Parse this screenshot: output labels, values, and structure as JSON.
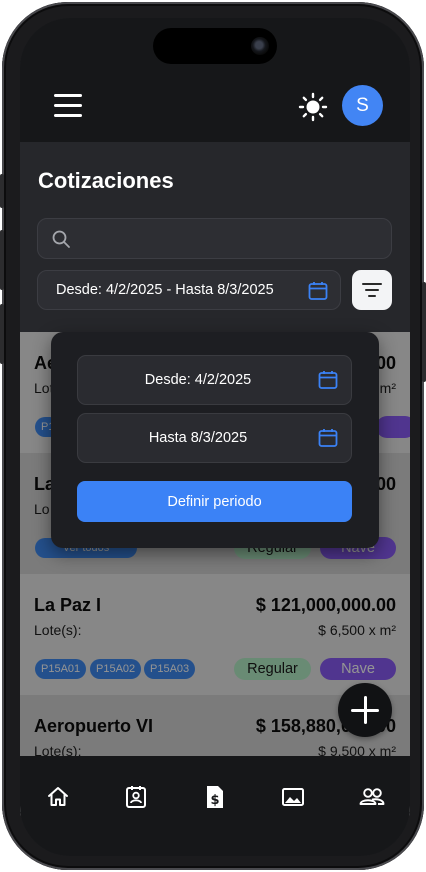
{
  "header": {
    "avatar_initial": "S"
  },
  "page": {
    "title": "Cotizaciones"
  },
  "search": {
    "placeholder": ""
  },
  "filter": {
    "range_text": "Desde: 4/2/2025 - Hasta 8/3/2025"
  },
  "popover": {
    "from_text": "Desde: 4/2/2025",
    "to_text": "Hasta 8/3/2025",
    "define_button": "Definir periodo"
  },
  "quotes": [
    {
      "name": "Ae",
      "price": "00",
      "lots_label": "Lot",
      "rate": "m²",
      "chips": [
        "P1"
      ],
      "status": "",
      "type": ""
    },
    {
      "name": "La",
      "price": "00",
      "lots_label": "Lo",
      "rate": "",
      "see_all": "Ver todos",
      "status": "Regular",
      "type": "Nave"
    },
    {
      "name": "La Paz I",
      "price": "$ 121,000,000.00",
      "lots_label": "Lote(s):",
      "rate": "$ 6,500 x m²",
      "chips": [
        "P15A01",
        "P15A02",
        "P15A03"
      ],
      "status": "Regular",
      "type": "Nave"
    },
    {
      "name": "Aeropuerto VI",
      "price": "$ 158,880,000.00",
      "lots_label": "Lote(s):",
      "rate": "$ 9,500 x m²"
    }
  ],
  "colors": {
    "accent_blue": "#3b82f6",
    "status_regular": "#b6efc9",
    "type_nave": "#8b5cf6",
    "card_light": "#e8e8e8",
    "card_alt": "#d4d4d4"
  },
  "icons": [
    "menu-icon",
    "sun-icon",
    "search-icon",
    "calendar-icon",
    "filter-icon",
    "plus-icon",
    "home-icon",
    "contacts-icon",
    "invoice-icon",
    "image-icon",
    "users-icon"
  ]
}
